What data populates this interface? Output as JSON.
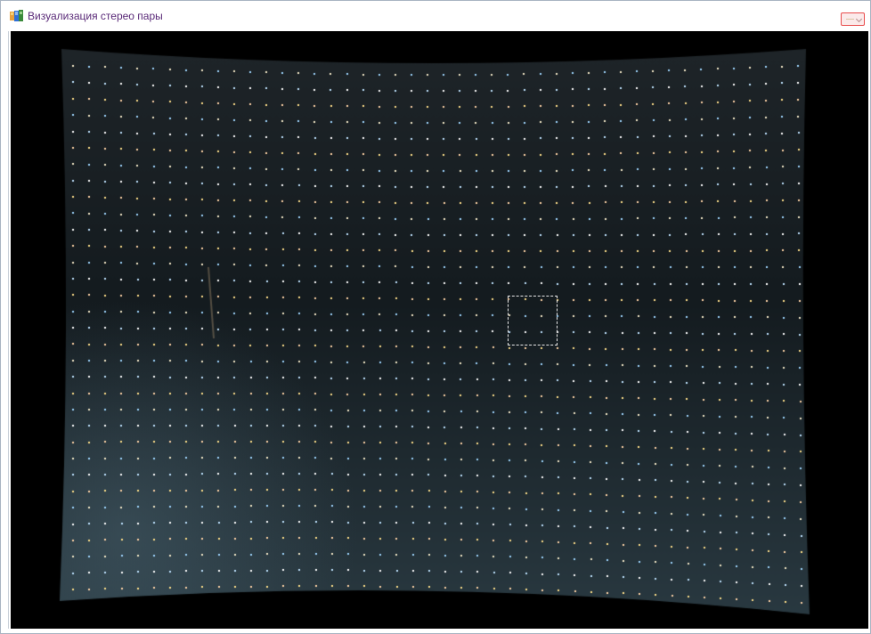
{
  "window": {
    "title": "Визуализация стерео пары"
  },
  "icons": {
    "app": "book-icon",
    "minimize": "minimize-icon"
  },
  "colors": {
    "title_text": "#5a2a78",
    "viewer_background": "#000000",
    "board_surface": "#1a2226",
    "selection_border": "#e6e6e6",
    "window_button_border": "#e84c4c"
  },
  "viewer": {
    "content": "calibration-dot-grid"
  }
}
